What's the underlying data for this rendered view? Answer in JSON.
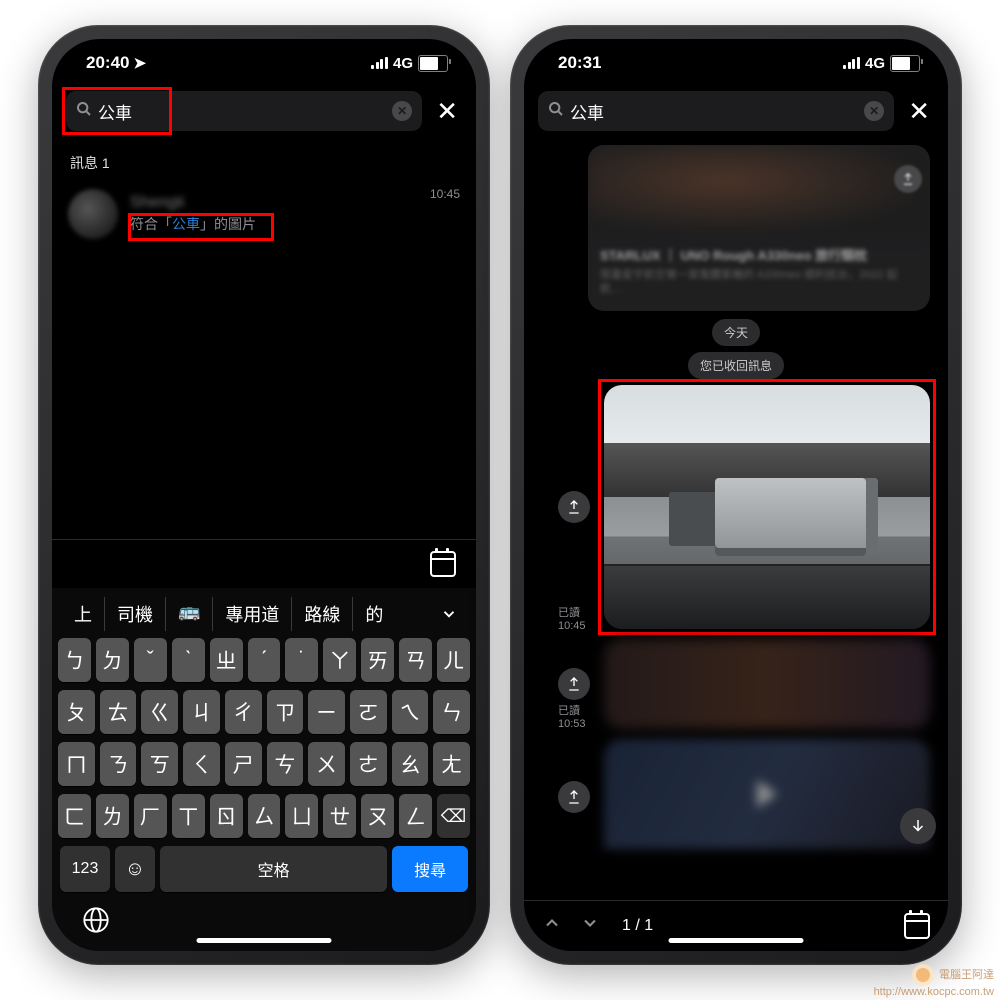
{
  "left": {
    "status": {
      "time": "20:40",
      "network": "4G"
    },
    "search": {
      "query": "公車"
    },
    "section_label": "訊息 1",
    "result": {
      "name": "Shengti",
      "prefix": "符合「",
      "keyword": "公車",
      "suffix": "」的圖片",
      "time": "10:45"
    },
    "suggestions": [
      "上",
      "司機",
      "🚌",
      "專用道",
      "路線",
      "的"
    ],
    "keyboard": {
      "row1": [
        "ㄅ",
        "ㄉ",
        "ˇ",
        "ˋ",
        "ㄓ",
        "ˊ",
        "˙",
        "ㄚ",
        "ㄞ",
        "ㄢ",
        "ㄦ"
      ],
      "row2": [
        "ㄆ",
        "ㄊ",
        "ㄍ",
        "ㄐ",
        "ㄔ",
        "ㄗ",
        "ㄧ",
        "ㄛ",
        "ㄟ",
        "ㄣ"
      ],
      "row3": [
        "ㄇ",
        "ㄋ",
        "ㄎ",
        "ㄑ",
        "ㄕ",
        "ㄘ",
        "ㄨ",
        "ㄜ",
        "ㄠ",
        "ㄤ"
      ],
      "row4_core": [
        "ㄈ",
        "ㄌ",
        "ㄏ",
        "ㄒ",
        "ㄖ",
        "ㄙ",
        "ㄩ",
        "ㄝ",
        "ㄡ",
        "ㄥ"
      ],
      "num": "123",
      "space": "空格",
      "search": "搜尋"
    }
  },
  "right": {
    "status": {
      "time": "20:31",
      "network": "4G"
    },
    "search": {
      "query": "公車"
    },
    "card": {
      "title": "STARLUX ｜ UNO Rough A330neo 旅行頸枕",
      "sub": "限量星宇航空第一架寬體客機的 A330neo 順利抵台，2022 起航… "
    },
    "date_pill": "今天",
    "recall_pill": "您已收回訊息",
    "msg1": {
      "read": "已讀",
      "time": "10:45"
    },
    "msg2": {
      "read": "已讀",
      "time": "10:53"
    },
    "counter": "1 / 1"
  },
  "watermark": {
    "line1": "電腦王阿達",
    "line2": "http://www.kocpc.com.tw"
  }
}
